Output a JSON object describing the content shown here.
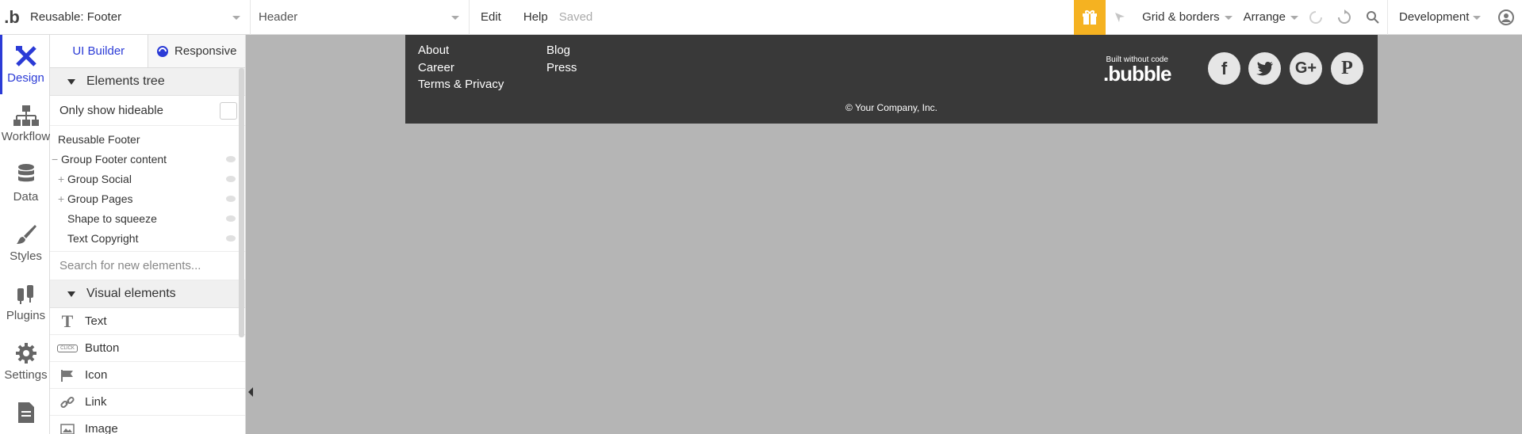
{
  "topbar": {
    "logo": ".b",
    "page_select": "Reusable: Footer",
    "element_select": "Header",
    "menu_edit": "Edit",
    "menu_help": "Help",
    "status": "Saved",
    "grid_borders": "Grid & borders",
    "arrange": "Arrange",
    "environment": "Development"
  },
  "nav": [
    {
      "label": "Design"
    },
    {
      "label": "Workflow"
    },
    {
      "label": "Data"
    },
    {
      "label": "Styles"
    },
    {
      "label": "Plugins"
    },
    {
      "label": "Settings"
    }
  ],
  "panel": {
    "tab_builder": "UI Builder",
    "tab_responsive": "Responsive",
    "elements_tree_title": "Elements tree",
    "only_hideable": "Only show hideable",
    "tree": [
      "Reusable Footer",
      "Group Footer content",
      "Group Social",
      "Group Pages",
      "Shape to squeeze",
      "Text Copyright"
    ],
    "search_placeholder": "Search for new elements...",
    "visual_title": "Visual elements",
    "visual": [
      "Text",
      "Button",
      "Icon",
      "Link",
      "Image"
    ],
    "button_icon_text": "CLICK"
  },
  "footer": {
    "links_col1": [
      "About",
      "Career",
      "Terms & Privacy"
    ],
    "links_col2": [
      "Blog",
      "Press"
    ],
    "built_without": "Built without code",
    "brand": ".bubble",
    "copyright": "© Your Company, Inc.",
    "social": [
      "facebook",
      "twitter",
      "google-plus",
      "pinterest"
    ]
  },
  "colors": {
    "accent": "#2b3bd6",
    "gift": "#f5b221",
    "footer_bg": "#393939",
    "canvas": "#b5b5b5"
  }
}
